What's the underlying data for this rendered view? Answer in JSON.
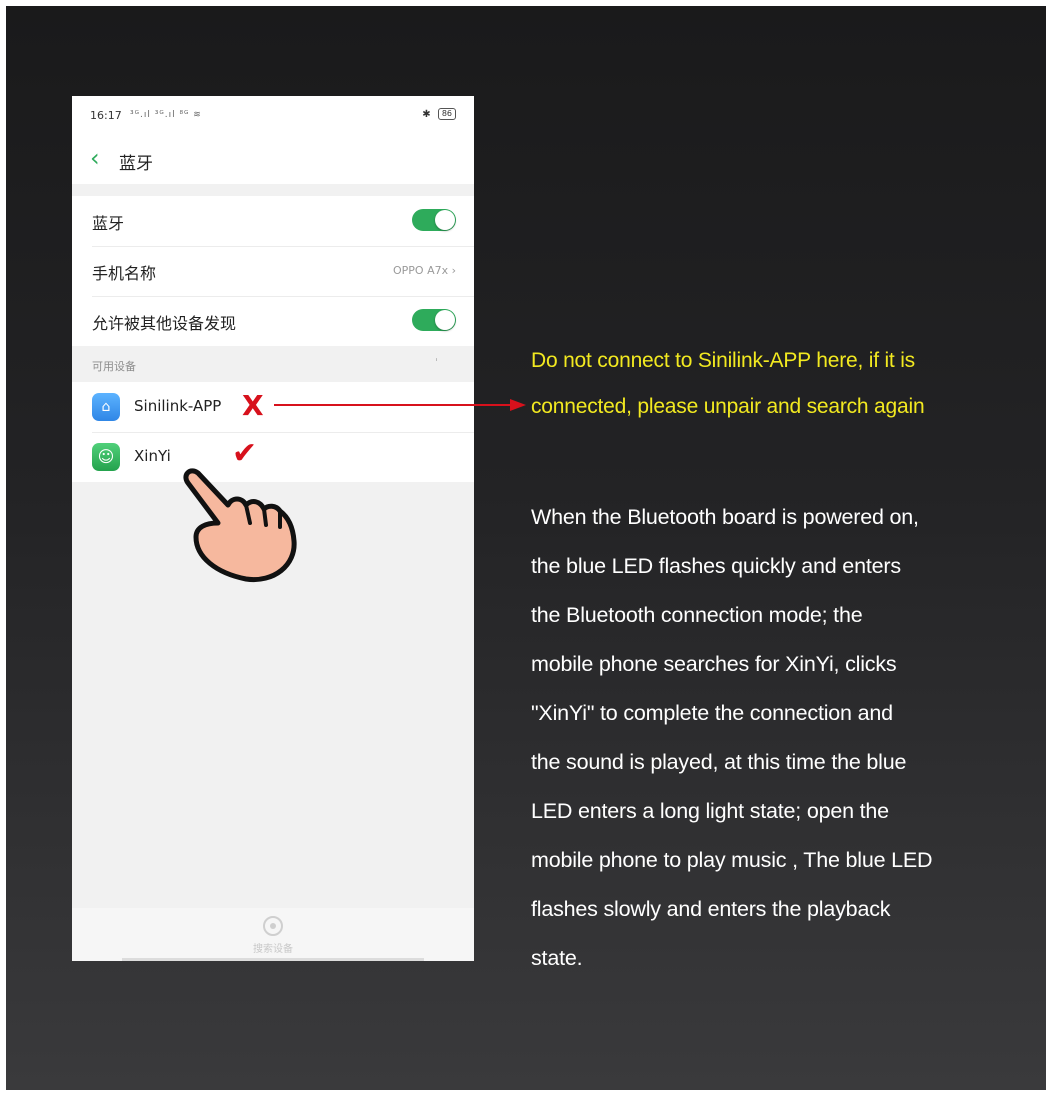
{
  "status_bar": {
    "time": "16:17",
    "signal": "³ᴳ.ıl ³ᴳ.ıl ⁸ᴳ ≋",
    "bluetooth": "✱",
    "battery": "86"
  },
  "nav": {
    "title": "蓝牙"
  },
  "settings": {
    "bluetooth_label": "蓝牙",
    "phone_name_label": "手机名称",
    "phone_name_value": "OPPO A7x ›",
    "discoverable_label": "允许被其他设备发现"
  },
  "devices": {
    "section_label": "可用设备",
    "items": [
      {
        "name": "Sinilink-APP",
        "mark": "X"
      },
      {
        "name": "XinYi",
        "mark": "✔"
      }
    ]
  },
  "bottom": {
    "search_label": "搜索设备"
  },
  "annotation": {
    "warning_lines": [
      "Do not connect to Sinilink-APP here, if it is",
      "connected, please unpair and search again"
    ],
    "description_lines": [
      "When the Bluetooth board is powered on,",
      "the blue LED flashes quickly and enters",
      "the Bluetooth connection mode; the",
      "mobile phone searches for XinYi, clicks",
      "\"XinYi\" to complete the connection and",
      "the sound is played, at this time the blue",
      "LED enters a long light state; open the",
      "mobile phone to play music , The blue LED",
      "flashes slowly and enters the playback",
      "state."
    ]
  },
  "colors": {
    "accent_green": "#2eab5b",
    "warning_yellow": "#f2e920",
    "mark_red": "#d7111c"
  }
}
